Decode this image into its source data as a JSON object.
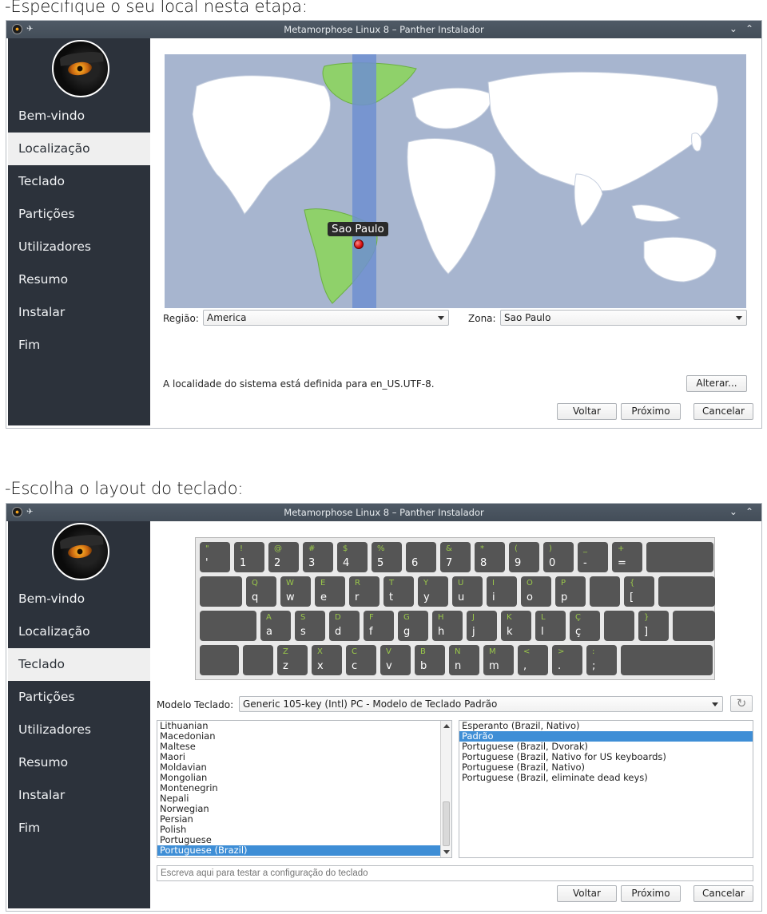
{
  "captions": {
    "step1": "-Especifique o seu local nesta etapa:",
    "step2": "-Escolha o layout do teclado:"
  },
  "window": {
    "title": "Metamorphose Linux 8 – Panther Instalador",
    "minimize_icon": "chevron-down-icon",
    "maximize_icon": "chevron-up-icon"
  },
  "sidebar": {
    "items": [
      "Bem-vindo",
      "Localização",
      "Teclado",
      "Partições",
      "Utilizadores",
      "Resumo",
      "Instalar",
      "Fim"
    ]
  },
  "location": {
    "active_item": "Localização",
    "pin_label": "Sao Paulo",
    "region_label": "Região:",
    "region_value": "America",
    "zone_label": "Zona:",
    "zone_value": "Sao Paulo",
    "locale_text": "A localidade do sistema está definida para en_US.UTF-8.",
    "change_button": "Alterar..."
  },
  "keyboard": {
    "active_item": "Teclado",
    "model_label": "Modelo Teclado:",
    "model_value": "Generic 105-key (Intl) PC  -  Modelo de Teclado Padrão",
    "rows": [
      [
        [
          "\"",
          "'"
        ],
        [
          "!",
          "1"
        ],
        [
          "@",
          "2"
        ],
        [
          "#",
          "3"
        ],
        [
          "$",
          "4"
        ],
        [
          "%",
          "5"
        ],
        [
          "",
          "6"
        ],
        [
          "&",
          "7"
        ],
        [
          "*",
          "8"
        ],
        [
          "(",
          "9"
        ],
        [
          ")",
          "0"
        ],
        [
          "_",
          "-"
        ],
        [
          "+",
          "="
        ],
        [
          "",
          ""
        ]
      ],
      [
        [
          "",
          ""
        ],
        [
          "Q",
          "q"
        ],
        [
          "W",
          "w"
        ],
        [
          "E",
          "e"
        ],
        [
          "R",
          "r"
        ],
        [
          "T",
          "t"
        ],
        [
          "Y",
          "y"
        ],
        [
          "U",
          "u"
        ],
        [
          "I",
          "i"
        ],
        [
          "O",
          "o"
        ],
        [
          "P",
          "p"
        ],
        [
          "",
          ""
        ],
        [
          "{",
          "["
        ],
        [
          "",
          ""
        ]
      ],
      [
        [
          "",
          ""
        ],
        [
          "A",
          "a"
        ],
        [
          "S",
          "s"
        ],
        [
          "D",
          "d"
        ],
        [
          "F",
          "f"
        ],
        [
          "G",
          "g"
        ],
        [
          "H",
          "h"
        ],
        [
          "J",
          "j"
        ],
        [
          "K",
          "k"
        ],
        [
          "L",
          "l"
        ],
        [
          "Ç",
          "ç"
        ],
        [
          "",
          ""
        ],
        [
          "}",
          "]"
        ],
        [
          "",
          ""
        ]
      ],
      [
        [
          "",
          ""
        ],
        [
          "",
          ""
        ],
        [
          "Z",
          "z"
        ],
        [
          "X",
          "x"
        ],
        [
          "C",
          "c"
        ],
        [
          "V",
          "v"
        ],
        [
          "B",
          "b"
        ],
        [
          "N",
          "n"
        ],
        [
          "M",
          "m"
        ],
        [
          "<",
          ","
        ],
        [
          ">",
          "."
        ],
        [
          ":",
          ";"
        ],
        [
          "",
          ""
        ]
      ]
    ],
    "layouts": [
      "Lithuanian",
      "Macedonian",
      "Maltese",
      "Maori",
      "Moldavian",
      "Mongolian",
      "Montenegrin",
      "Nepali",
      "Norwegian",
      "Persian",
      "Polish",
      "Portuguese",
      "Portuguese (Brazil)"
    ],
    "selected_layout": "Portuguese (Brazil)",
    "variants": [
      "Esperanto (Brazil, Nativo)",
      "Padrão",
      "Portuguese (Brazil, Dvorak)",
      "Portuguese (Brazil, Nativo for US keyboards)",
      "Portuguese (Brazil, Nativo)",
      "Portuguese (Brazil, eliminate dead keys)"
    ],
    "selected_variant": "Padrão",
    "test_placeholder": "Escreva aqui para testar a configuração do teclado"
  },
  "buttons": {
    "back": "Voltar",
    "next": "Próximo",
    "cancel": "Cancelar"
  },
  "colors": {
    "sidebar_bg": "#2c323b",
    "titlebar_bg": "#4a5460",
    "map_ocean": "#a7b5cf",
    "map_land": "#ffffff",
    "map_highlight": "#8fd16a",
    "timezone_band": "#6e8fd0",
    "selection": "#3e8ed6",
    "key_bg": "#555555",
    "key_shift_text": "#9ac84a"
  }
}
